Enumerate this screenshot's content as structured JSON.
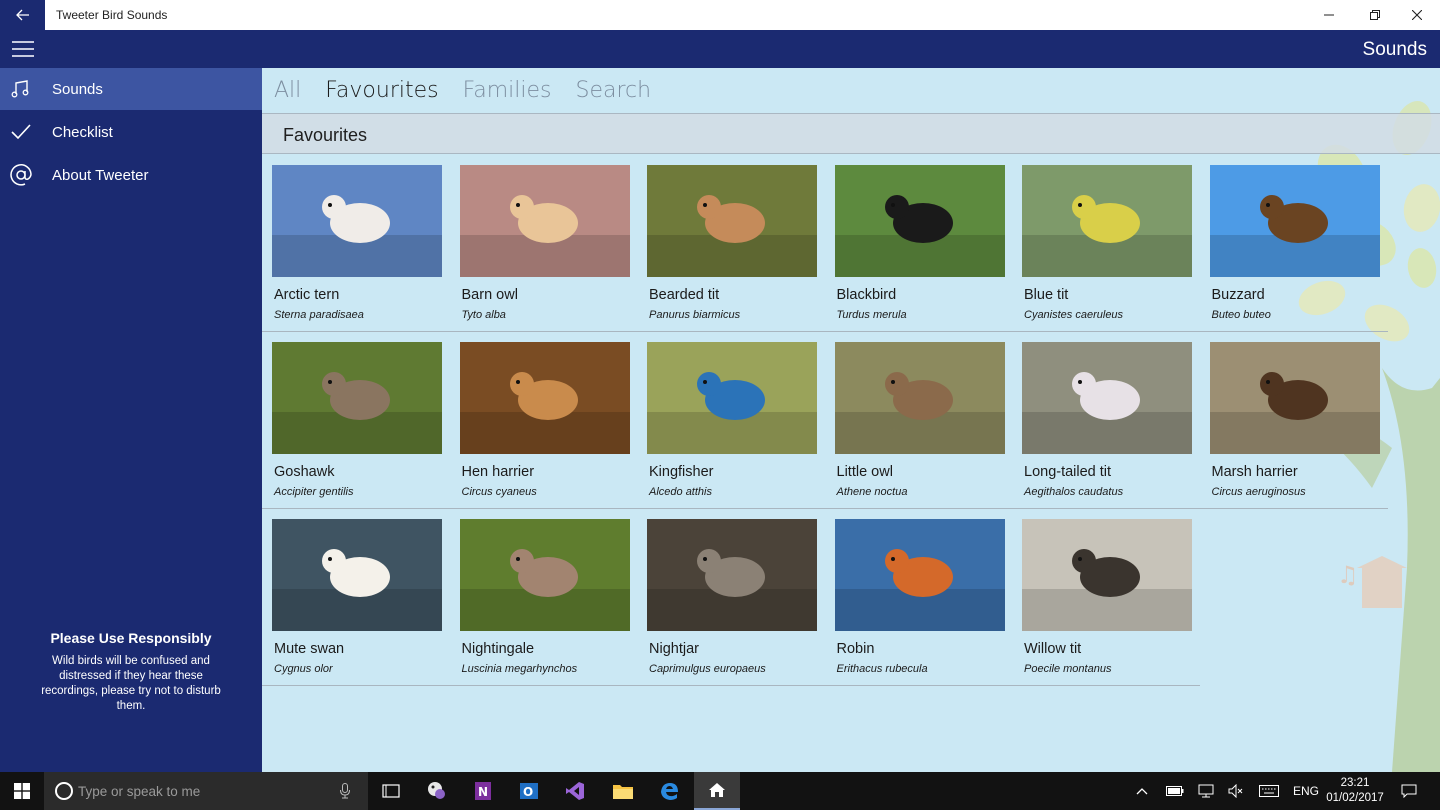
{
  "window": {
    "title": "Tweeter Bird Sounds"
  },
  "header": {
    "title": "Sounds"
  },
  "sidebar": {
    "items": [
      {
        "label": "Sounds",
        "icon": "music-note-icon"
      },
      {
        "label": "Checklist",
        "icon": "checkmark-icon"
      },
      {
        "label": "About Tweeter",
        "icon": "at-sign-icon"
      }
    ],
    "notice": {
      "title": "Please Use Responsibly",
      "body": "Wild birds will be confused and distressed if they hear these recordings, please try not to disturb them."
    }
  },
  "tabs": [
    "All",
    "Favourites",
    "Families",
    "Search"
  ],
  "active_tab": "Favourites",
  "section_title": "Favourites",
  "birds": [
    {
      "name": "Arctic tern",
      "latin": "Sterna paradisaea",
      "colors": [
        "#5f86c4",
        "#f0ece8"
      ]
    },
    {
      "name": "Barn owl",
      "latin": "Tyto alba",
      "colors": [
        "#b98a84",
        "#e9c598"
      ]
    },
    {
      "name": "Bearded tit",
      "latin": "Panurus biarmicus",
      "colors": [
        "#6f7a3a",
        "#c58b5a"
      ]
    },
    {
      "name": "Blackbird",
      "latin": "Turdus merula",
      "colors": [
        "#5d8a3e",
        "#1a1a1a"
      ]
    },
    {
      "name": "Blue tit",
      "latin": "Cyanistes caeruleus",
      "colors": [
        "#7e9a6a",
        "#d9cf49"
      ]
    },
    {
      "name": "Buzzard",
      "latin": "Buteo buteo",
      "colors": [
        "#4d9be6",
        "#6a4422"
      ]
    },
    {
      "name": "Goshawk",
      "latin": "Accipiter gentilis",
      "colors": [
        "#5f7a32",
        "#8a7560"
      ]
    },
    {
      "name": "Hen harrier",
      "latin": "Circus cyaneus",
      "colors": [
        "#7a4c23",
        "#c98b4c"
      ]
    },
    {
      "name": "Kingfisher",
      "latin": "Alcedo atthis",
      "colors": [
        "#9aa35a",
        "#2b73b8"
      ]
    },
    {
      "name": "Little owl",
      "latin": "Athene noctua",
      "colors": [
        "#8c8a5e",
        "#8b6a4b"
      ]
    },
    {
      "name": "Long-tailed tit",
      "latin": "Aegithalos caudatus",
      "colors": [
        "#8f8f7e",
        "#e7e1e6"
      ]
    },
    {
      "name": "Marsh harrier",
      "latin": "Circus aeruginosus",
      "colors": [
        "#9c8f73",
        "#4f3420"
      ]
    },
    {
      "name": "Mute swan",
      "latin": "Cygnus olor",
      "colors": [
        "#3f5462",
        "#f4f1ea"
      ]
    },
    {
      "name": "Nightingale",
      "latin": "Luscinia megarhynchos",
      "colors": [
        "#5f7d2e",
        "#a28470"
      ]
    },
    {
      "name": "Nightjar",
      "latin": "Caprimulgus europaeus",
      "colors": [
        "#4b4339",
        "#8b8175"
      ]
    },
    {
      "name": "Robin",
      "latin": "Erithacus rubecula",
      "colors": [
        "#3a6ea8",
        "#d4692a"
      ]
    },
    {
      "name": "Willow tit",
      "latin": "Poecile montanus",
      "colors": [
        "#c7c3b9",
        "#3a342e"
      ]
    }
  ],
  "taskbar": {
    "search_placeholder": "Type or speak to me",
    "language": "ENG",
    "time": "23:21",
    "date": "01/02/2017"
  }
}
